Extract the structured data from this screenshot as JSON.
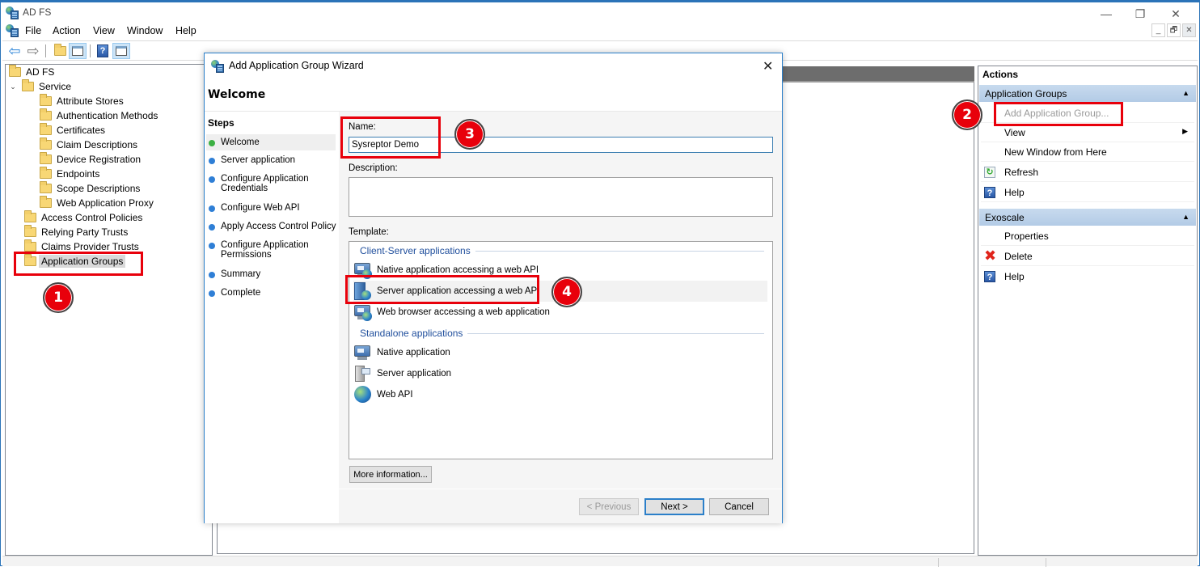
{
  "window": {
    "title": "AD FS",
    "controls": {
      "minimize": "—",
      "restore": "❐",
      "close": "✕"
    },
    "mdi_controls": {
      "minimize": "_",
      "restore": "🗗",
      "close": "✕"
    }
  },
  "menubar": {
    "items": [
      "File",
      "Action",
      "View",
      "Window",
      "Help"
    ]
  },
  "toolbar": {
    "buttons": [
      {
        "icon": "back-arrow-icon",
        "glyph": "⇦"
      },
      {
        "icon": "forward-arrow-icon",
        "glyph": "⇨"
      },
      {
        "icon": "up-folder-icon",
        "glyph": ""
      },
      {
        "icon": "show-hide-console-tree-icon",
        "glyph": ""
      },
      {
        "icon": "help-icon",
        "glyph": "?"
      },
      {
        "icon": "show-hide-action-pane-icon",
        "glyph": ""
      }
    ]
  },
  "tree": {
    "root": "AD FS",
    "service": "Service",
    "service_children": [
      "Attribute Stores",
      "Authentication Methods",
      "Certificates",
      "Claim Descriptions",
      "Device Registration",
      "Endpoints",
      "Scope Descriptions",
      "Web Application Proxy"
    ],
    "top_items": [
      "Access Control Policies",
      "Relying Party Trusts",
      "Claims Provider Trusts",
      "Application Groups"
    ],
    "selected": "Application Groups",
    "expand_glyph": "⌄"
  },
  "actions": {
    "title": "Actions",
    "sections": [
      {
        "header": "Application Groups",
        "collapse_glyph": "▲",
        "items": [
          {
            "label": "Add Application Group...",
            "disabled": true,
            "icon": ""
          },
          {
            "label": "View",
            "submenu": "▶",
            "icon": ""
          },
          {
            "label": "New Window from Here",
            "icon": ""
          },
          {
            "label": "Refresh",
            "icon": "refresh-icon",
            "glyph": "↻"
          },
          {
            "label": "Help",
            "icon": "help-icon",
            "glyph": "?"
          }
        ]
      },
      {
        "header": "Exoscale",
        "collapse_glyph": "▲",
        "items": [
          {
            "label": "Properties",
            "icon": ""
          },
          {
            "label": "Delete",
            "icon": "delete-icon",
            "glyph": "✖"
          },
          {
            "label": "Help",
            "icon": "help-icon",
            "glyph": "?"
          }
        ]
      }
    ]
  },
  "wizard": {
    "title": "Add Application Group Wizard",
    "close_glyph": "✕",
    "heading": "Welcome",
    "steps_title": "Steps",
    "steps": [
      {
        "label": "Welcome",
        "status": "current"
      },
      {
        "label": "Server application",
        "status": "pending"
      },
      {
        "label": "Configure Application Credentials",
        "status": "pending"
      },
      {
        "label": "Configure Web API",
        "status": "pending"
      },
      {
        "label": "Apply Access Control Policy",
        "status": "pending"
      },
      {
        "label": "Configure Application Permissions",
        "status": "pending"
      },
      {
        "label": "Summary",
        "status": "pending"
      },
      {
        "label": "Complete",
        "status": "pending"
      }
    ],
    "step_colors": {
      "current": "#3cb043",
      "pending": "#2f7fd6"
    },
    "name_label": "Name:",
    "name_value": "Sysreptor Demo",
    "description_label": "Description:",
    "description_value": "",
    "template_label": "Template:",
    "template_groups": [
      {
        "header": "Client-Server applications",
        "items": [
          {
            "label": "Native application accessing a web API",
            "icon": "native-app-web-api-icon"
          },
          {
            "label": "Server application accessing a web API",
            "icon": "server-app-web-api-icon",
            "highlighted": true
          },
          {
            "label": "Web browser accessing a web application",
            "icon": "web-browser-app-icon"
          }
        ]
      },
      {
        "header": "Standalone applications",
        "items": [
          {
            "label": "Native application",
            "icon": "native-app-icon"
          },
          {
            "label": "Server application",
            "icon": "server-app-icon"
          },
          {
            "label": "Web API",
            "icon": "web-api-icon"
          }
        ]
      }
    ],
    "more_info_label": "More information...",
    "buttons": {
      "previous": "< Previous",
      "next": "Next >",
      "cancel": "Cancel"
    }
  },
  "annotations": {
    "color": "#e8000b",
    "badges": [
      "1",
      "2",
      "3",
      "4"
    ]
  }
}
